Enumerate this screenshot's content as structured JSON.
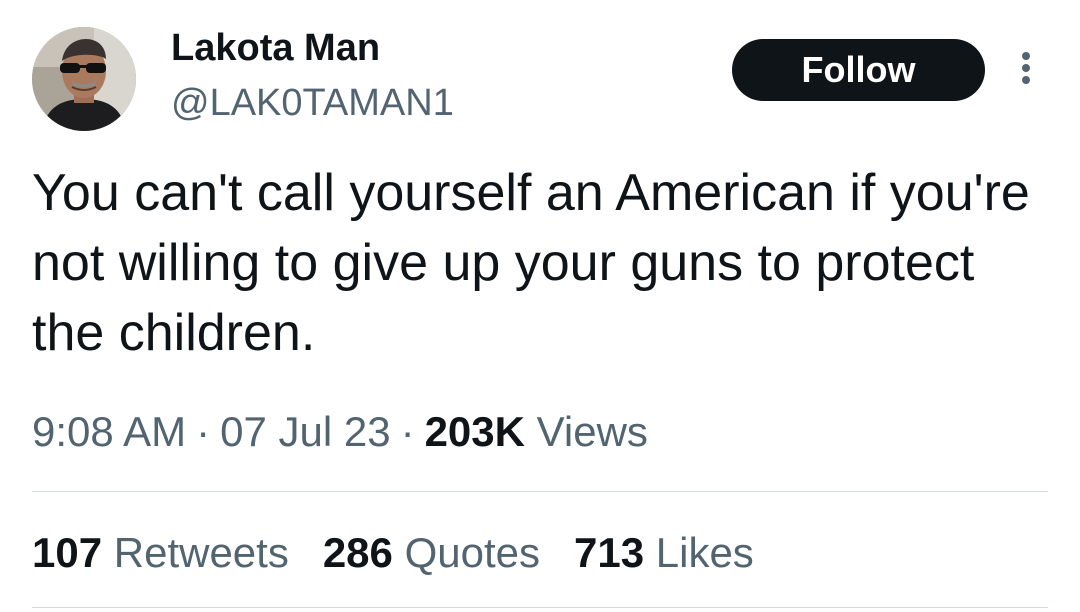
{
  "author": {
    "display_name": "Lakota Man",
    "handle": "@LAK0TAMAN1"
  },
  "actions": {
    "follow_label": "Follow",
    "more_icon": "more-vertical-icon"
  },
  "tweet": {
    "text": "You can't call yourself an American if you're not willing to give up your guns to protect the children.",
    "time": "9:08 AM",
    "separator": "·",
    "date": "07 Jul 23",
    "views_count": "203K",
    "views_label": "Views"
  },
  "stats": [
    {
      "count": "107",
      "label": "Retweets"
    },
    {
      "count": "286",
      "label": "Quotes"
    },
    {
      "count": "713",
      "label": "Likes"
    }
  ],
  "colors": {
    "text_primary": "#0f1419",
    "text_secondary": "#536471",
    "follow_bg": "#0f1419",
    "divider": "#cfd9de"
  }
}
